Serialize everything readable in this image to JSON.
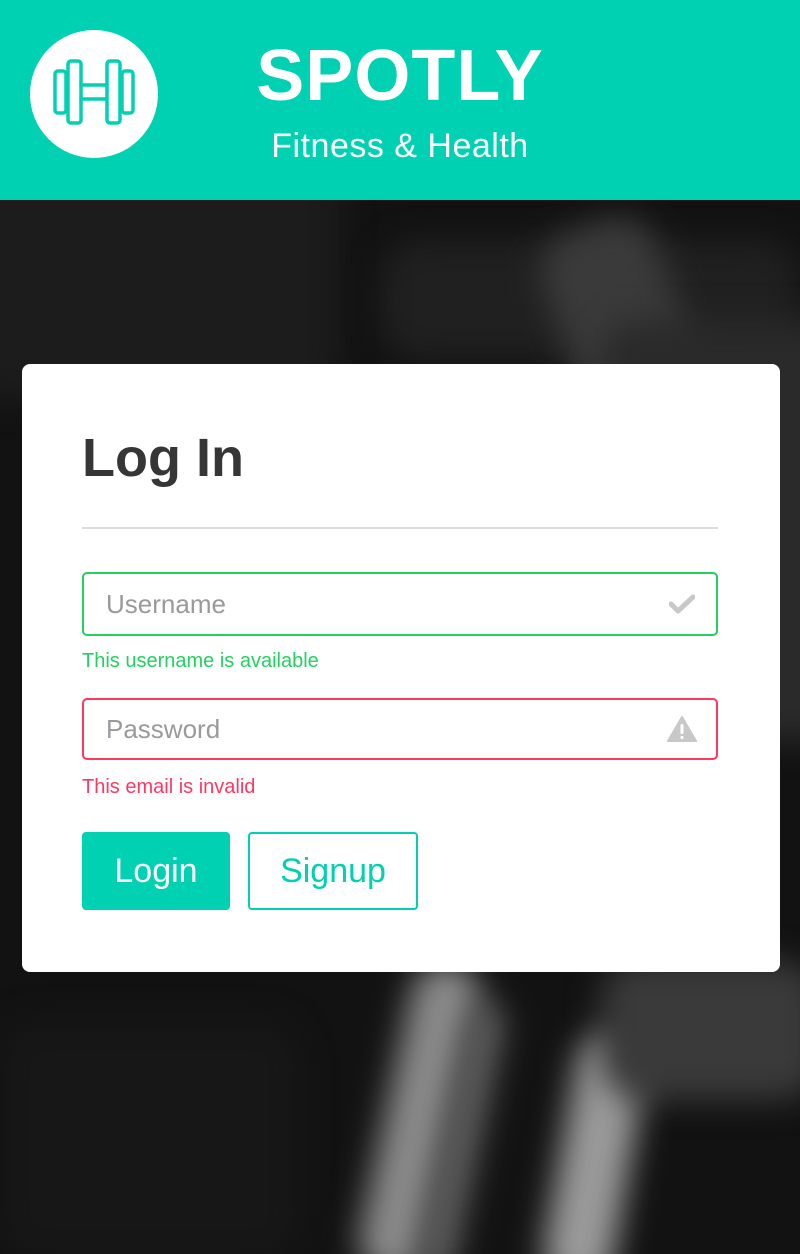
{
  "header": {
    "brand_title": "SPOTLY",
    "brand_subtitle": "Fitness & Health",
    "logo_icon": "dumbbell-icon",
    "background_color": "#00d1b2"
  },
  "login_card": {
    "title": "Log In",
    "username": {
      "placeholder": "Username",
      "value": "",
      "state": "success",
      "icon": "check-icon",
      "help_text": "This username is available"
    },
    "password": {
      "placeholder": "Password",
      "value": "",
      "state": "danger",
      "icon": "warning-icon",
      "help_text": "This email is invalid"
    },
    "login_button_label": "Login",
    "signup_button_label": "Signup"
  },
  "colors": {
    "primary": "#00d1b2",
    "success": "#23d160",
    "danger": "#ff3860",
    "text": "#363636"
  }
}
